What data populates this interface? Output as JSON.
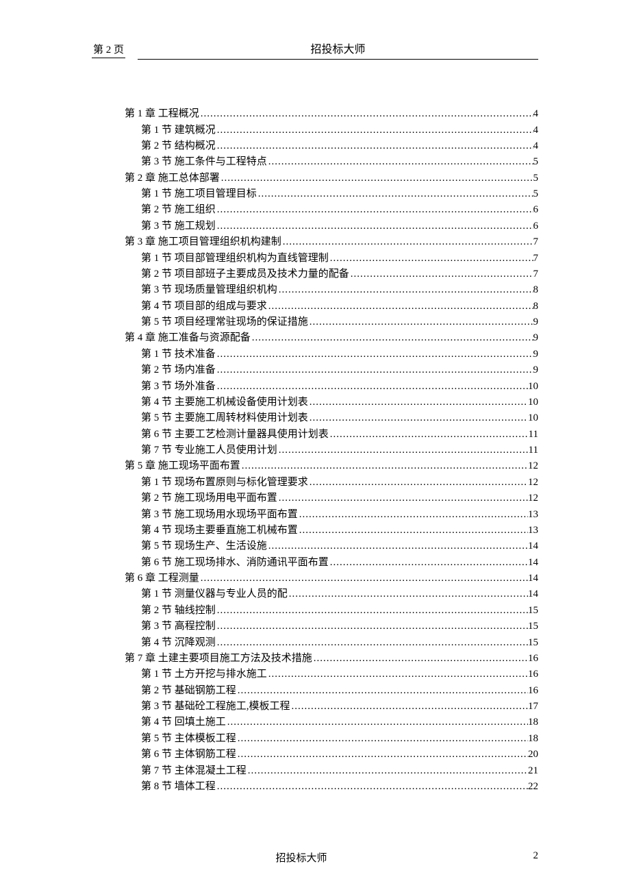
{
  "header": {
    "page_label": "第 2 页",
    "title": "招投标大师"
  },
  "toc": [
    {
      "level": 1,
      "label": "第 1 章  工程概况",
      "page": "4"
    },
    {
      "level": 2,
      "label": "第 1 节  建筑概况",
      "page": "4"
    },
    {
      "level": 2,
      "label": "第 2 节  结构概况",
      "page": "4"
    },
    {
      "level": 2,
      "label": "第 3 节  施工条件与工程特点",
      "page": "5"
    },
    {
      "level": 1,
      "label": "第 2 章  施工总体部署",
      "page": "5"
    },
    {
      "level": 2,
      "label": "第 1 节  施工项目管理目标",
      "page": "5"
    },
    {
      "level": 2,
      "label": "第 2 节  施工组织",
      "page": "6"
    },
    {
      "level": 2,
      "label": "第 3 节  施工规划",
      "page": "6"
    },
    {
      "level": 1,
      "label": "第 3 章  施工项目管理组织机构建制",
      "page": "7"
    },
    {
      "level": 2,
      "label": "第 1 节  项目部管理组织机构为直线管理制",
      "page": "7"
    },
    {
      "level": 2,
      "label": "第 2 节  项目部班子主要成员及技术力量的配备",
      "page": "7"
    },
    {
      "level": 2,
      "label": "第 3 节  现场质量管理组织机构",
      "page": "8"
    },
    {
      "level": 2,
      "label": "第 4 节  项目部的组成与要求",
      "page": "8"
    },
    {
      "level": 2,
      "label": "第 5 节  项目经理常驻现场的保证措施",
      "page": "9"
    },
    {
      "level": 1,
      "label": "第 4 章  施工准备与资源配备",
      "page": "9"
    },
    {
      "level": 2,
      "label": "第 1 节  技术准备",
      "page": "9"
    },
    {
      "level": 2,
      "label": "第 2 节  场内准备",
      "page": "9"
    },
    {
      "level": 2,
      "label": "第 3 节  场外准备",
      "page": "10"
    },
    {
      "level": 2,
      "label": "第 4 节  主要施工机械设备使用计划表",
      "page": "10"
    },
    {
      "level": 2,
      "label": "第 5 节  主要施工周转材料使用计划表",
      "page": "10"
    },
    {
      "level": 2,
      "label": "第 6 节  主要工艺检测计量器具使用计划表",
      "page": "11"
    },
    {
      "level": 2,
      "label": "第 7 节  专业施工人员使用计划",
      "page": "11"
    },
    {
      "level": 1,
      "label": "第 5 章  施工现场平面布置",
      "page": "12"
    },
    {
      "level": 2,
      "label": "第 1 节  现场布置原则与标化管理要求",
      "page": "12"
    },
    {
      "level": 2,
      "label": "第 2 节  施工现场用电平面布置",
      "page": "12"
    },
    {
      "level": 2,
      "label": "第 3 节  施工现场用水现场平面布置",
      "page": "13"
    },
    {
      "level": 2,
      "label": "第 4 节  现场主要垂直施工机械布置",
      "page": "13"
    },
    {
      "level": 2,
      "label": "第 5 节  现场生产、生活设施",
      "page": "14"
    },
    {
      "level": 2,
      "label": "第 6 节  施工现场排水、消防通讯平面布置",
      "page": "14"
    },
    {
      "level": 1,
      "label": "第 6 章  工程测量",
      "page": "14"
    },
    {
      "level": 2,
      "label": "第 1 节  测量仪器与专业人员的配",
      "page": "14"
    },
    {
      "level": 2,
      "label": "第 2 节  轴线控制",
      "page": "15"
    },
    {
      "level": 2,
      "label": "第 3 节  高程控制",
      "page": "15"
    },
    {
      "level": 2,
      "label": "第 4 节  沉降观测",
      "page": "15"
    },
    {
      "level": 1,
      "label": "第 7 章  土建主要项目施工方法及技术措施",
      "page": "16"
    },
    {
      "level": 2,
      "label": "第 1 节  土方开挖与排水施工",
      "page": "16"
    },
    {
      "level": 2,
      "label": "第 2 节  基础钢筋工程",
      "page": "16"
    },
    {
      "level": 2,
      "label": "第 3 节  基础砼工程施工,模板工程",
      "page": "17"
    },
    {
      "level": 2,
      "label": "第 4 节  回填土施工",
      "page": "18"
    },
    {
      "level": 2,
      "label": "第 5 节  主体模板工程",
      "page": "18"
    },
    {
      "level": 2,
      "label": "第 6 节  主体钢筋工程",
      "page": "20"
    },
    {
      "level": 2,
      "label": "第 7 节  主体混凝土工程",
      "page": "21"
    },
    {
      "level": 2,
      "label": "第 8 节  墙体工程",
      "page": "22"
    }
  ],
  "footer": {
    "title": "招投标大师",
    "page_number": "2"
  }
}
